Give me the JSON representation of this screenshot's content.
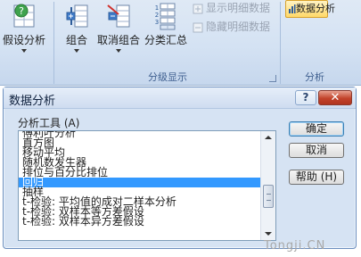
{
  "ribbon": {
    "what_if_label": "假设分析",
    "group_label": "组合",
    "ungroup_label": "取消组合",
    "subtotal_label": "分类汇总",
    "show_detail_label": "显示明细数据",
    "hide_detail_label": "隐藏明细数据",
    "outline_group_label": "分级显示",
    "data_analysis_label": "数据分析",
    "analysis_group_label": "分析"
  },
  "dialog": {
    "title": "数据分析",
    "help_glyph": "?",
    "close_glyph": "✕",
    "tools_label": "分析工具 (A)",
    "items": [
      "傅利叶分析",
      "直方图",
      "移动平均",
      "随机数发生器",
      "排位与百分比排位",
      "回归",
      "抽样",
      "t-检验: 平均值的成对二样本分析",
      "t-检验: 双样本等方差假设",
      "t-检验: 双样本异方差假设"
    ],
    "selected_item": "回归",
    "ok_label": "确定",
    "cancel_label": "取消",
    "help_label": "帮助 (H)"
  },
  "watermark": "Tongji.CN"
}
